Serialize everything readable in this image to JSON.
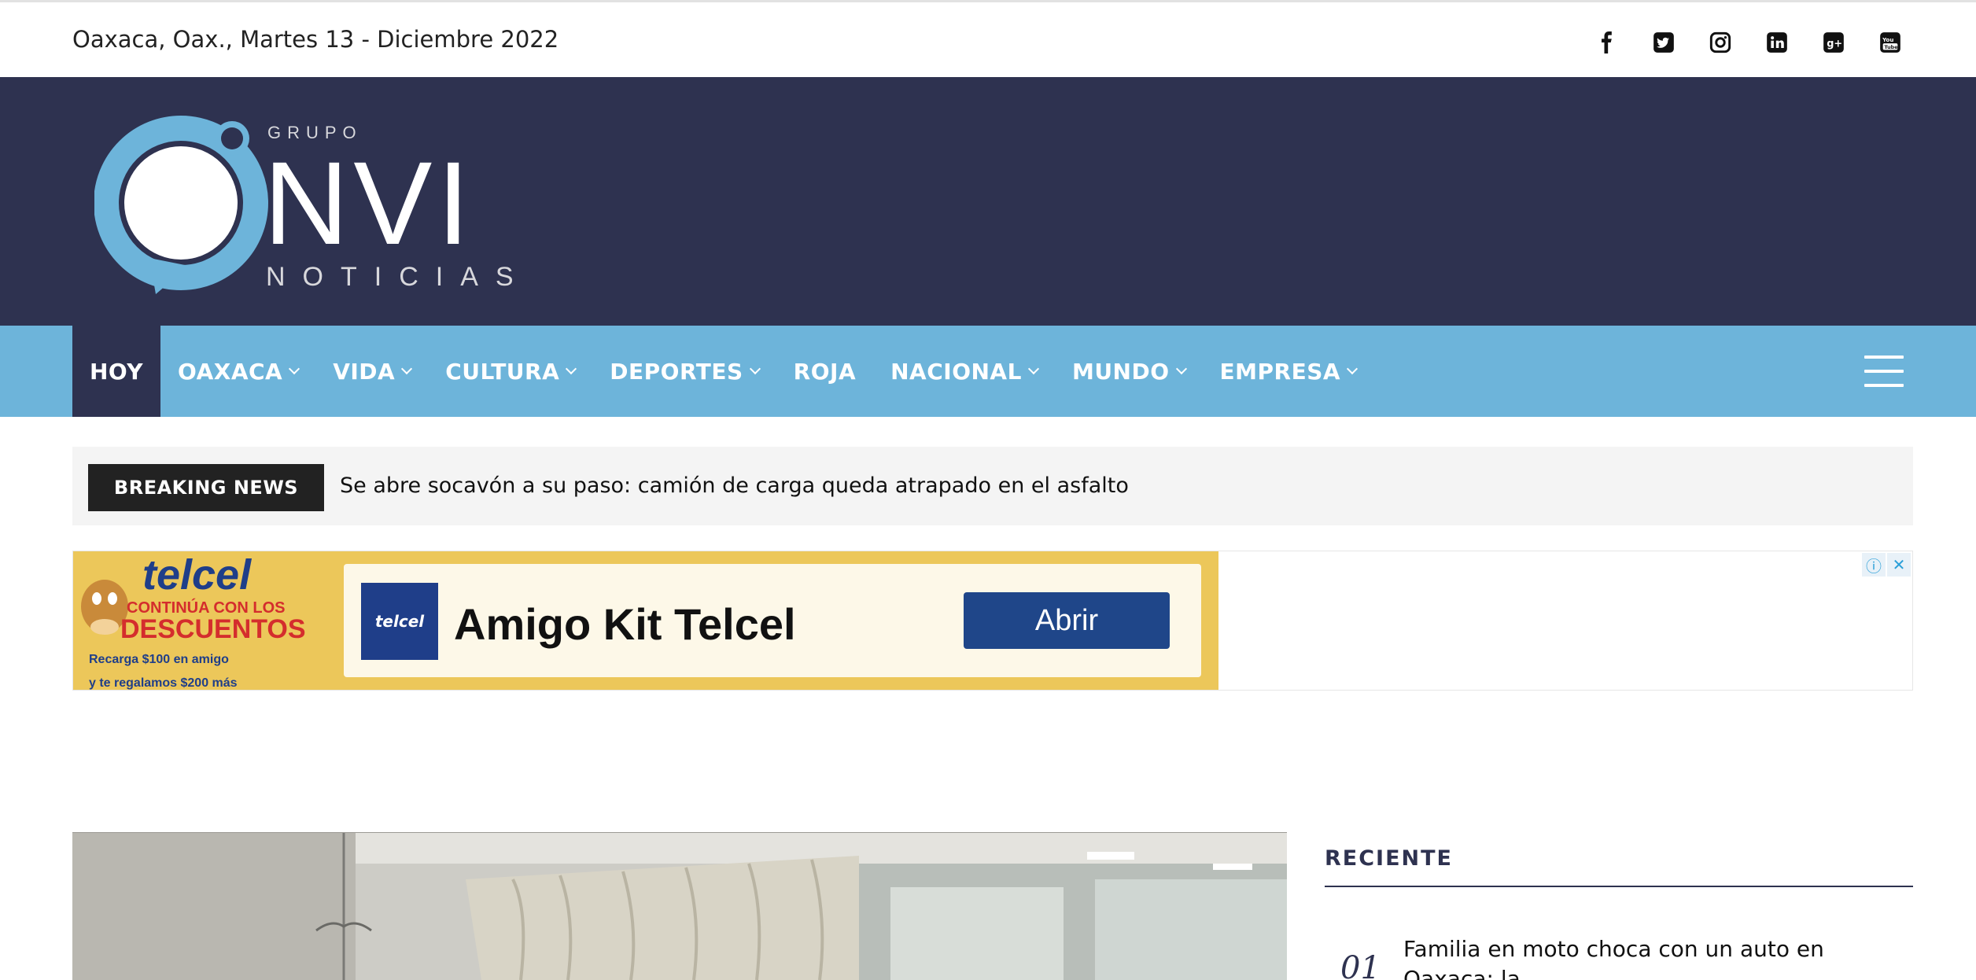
{
  "topbar": {
    "date": "Oaxaca, Oax., Martes 13 - Diciembre 2022",
    "social": [
      "facebook-icon",
      "twitter-icon",
      "instagram-icon",
      "linkedin-icon",
      "google-plus-icon",
      "youtube-icon"
    ]
  },
  "logo": {
    "brand_top": "GRUPO",
    "brand_main": "NVI",
    "brand_bottom": "NOTICIAS"
  },
  "nav": {
    "items": [
      {
        "label": "HOY",
        "dropdown": false,
        "active": true
      },
      {
        "label": "OAXACA",
        "dropdown": true
      },
      {
        "label": "VIDA",
        "dropdown": true
      },
      {
        "label": "CULTURA",
        "dropdown": true
      },
      {
        "label": "DEPORTES",
        "dropdown": true
      },
      {
        "label": "ROJA",
        "dropdown": false
      },
      {
        "label": "NACIONAL",
        "dropdown": true
      },
      {
        "label": "MUNDO",
        "dropdown": true
      },
      {
        "label": "EMPRESA",
        "dropdown": true
      }
    ]
  },
  "breaking": {
    "label": "BREAKING NEWS",
    "headline": "Se abre socavón a su paso: camión de carga queda atrapado en el asfalto"
  },
  "ad": {
    "promo_brand": "telcel",
    "promo_line1": "CONTINÚA CON LOS",
    "promo_line2": "DESCUENTOS",
    "promo_line3": "Recarga $100 en amigo",
    "promo_line4": "y te regalamos $200 más",
    "logo_text": "telcel",
    "title": "Amigo Kit Telcel",
    "cta": "Abrir",
    "colors": {
      "banner": "#ecc75a",
      "button": "#1f4689"
    }
  },
  "recent": {
    "heading": "RECIENTE",
    "items": [
      {
        "num": "01",
        "title": "Familia en moto choca con un auto en Oaxaca; la"
      }
    ]
  },
  "colors": {
    "header": "#2e3250",
    "nav": "#6db4da"
  }
}
